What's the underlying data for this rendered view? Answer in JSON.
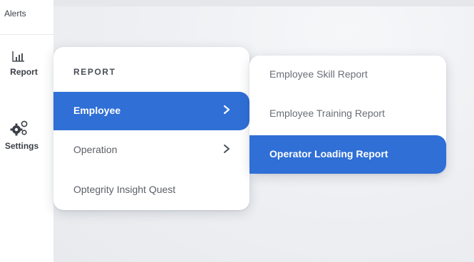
{
  "sidebar": {
    "alerts_label": "Alerts",
    "report_label": "Report",
    "settings_label": "Settings",
    "report_icon": "bar-chart-icon",
    "settings_icon": "gears-icon"
  },
  "menu": {
    "heading": "REPORT",
    "items": [
      {
        "label": "Employee",
        "has_submenu": true,
        "active": true
      },
      {
        "label": "Operation",
        "has_submenu": true,
        "active": false
      },
      {
        "label": "Optegrity Insight Quest",
        "has_submenu": false,
        "active": false
      }
    ]
  },
  "submenu": {
    "items": [
      {
        "label": "Employee Skill Report",
        "active": false
      },
      {
        "label": "Employee Training Report",
        "active": false
      },
      {
        "label": "Operator Loading Report",
        "active": true
      }
    ]
  },
  "colors": {
    "accent": "#2f6fd6",
    "text": "#5b5f67",
    "background": "#e9ebef"
  }
}
